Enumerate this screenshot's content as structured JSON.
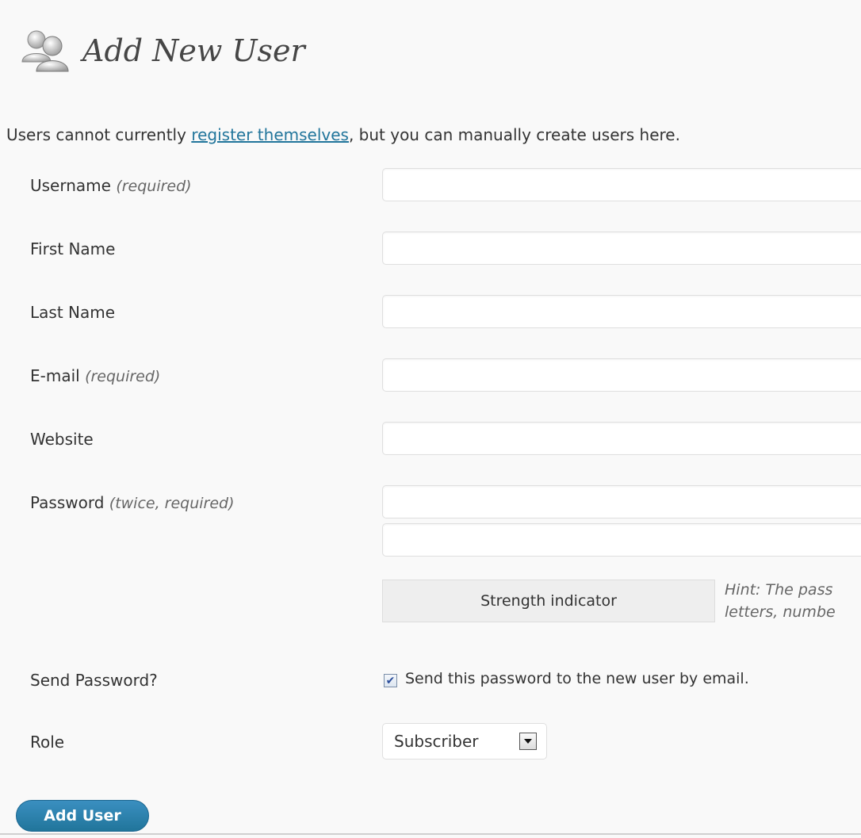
{
  "header": {
    "title": "Add New User",
    "icon": "users-icon"
  },
  "intro": {
    "before": "Users cannot currently ",
    "link": "register themselves",
    "after": ", but you can manually create users here."
  },
  "form": {
    "username": {
      "label": "Username",
      "note": "(required)",
      "value": ""
    },
    "first_name": {
      "label": "First Name",
      "value": ""
    },
    "last_name": {
      "label": "Last Name",
      "value": ""
    },
    "email": {
      "label": "E-mail",
      "note": "(required)",
      "value": ""
    },
    "website": {
      "label": "Website",
      "value": ""
    },
    "password": {
      "label": "Password",
      "note": "(twice, required)",
      "value1": "",
      "value2": ""
    },
    "strength": {
      "label": "Strength indicator"
    },
    "hint": {
      "line1": "Hint: The pass",
      "line2": "letters, numbe"
    },
    "send_password": {
      "label": "Send Password?",
      "checkbox_label": "Send this password to the new user by email.",
      "checked": true
    },
    "role": {
      "label": "Role",
      "selected": "Subscriber",
      "icon": "chevron-down-icon"
    }
  },
  "submit": {
    "label": "Add User"
  },
  "colors": {
    "link": "#21759b",
    "button": "#21759b",
    "background": "#f9f9f9"
  }
}
